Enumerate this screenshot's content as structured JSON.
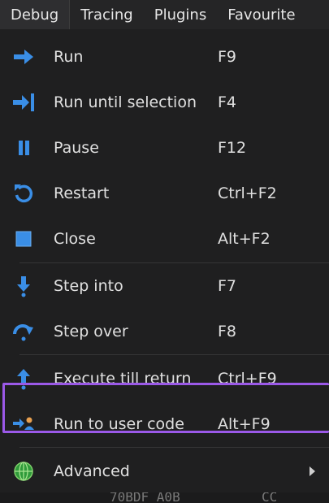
{
  "menubar": {
    "items": [
      {
        "label": "Debug"
      },
      {
        "label": "Tracing"
      },
      {
        "label": "Plugins"
      },
      {
        "label": "Favourite"
      }
    ]
  },
  "debug_menu": {
    "items": [
      {
        "label": "Run",
        "shortcut": "F9",
        "icon": "run-arrow-icon"
      },
      {
        "label": "Run until selection",
        "shortcut": "F4",
        "icon": "run-until-selection-icon"
      },
      {
        "label": "Pause",
        "shortcut": "F12",
        "icon": "pause-icon"
      },
      {
        "label": "Restart",
        "shortcut": "Ctrl+F2",
        "icon": "restart-icon"
      },
      {
        "label": "Close",
        "shortcut": "Alt+F2",
        "icon": "stop-icon"
      },
      {
        "label": "Step into",
        "shortcut": "F7",
        "icon": "step-into-icon"
      },
      {
        "label": "Step over",
        "shortcut": "F8",
        "icon": "step-over-icon"
      },
      {
        "label": "Execute till return",
        "shortcut": "Ctrl+F9",
        "icon": "execute-till-return-icon"
      },
      {
        "label": "Run to user code",
        "shortcut": "Alt+F9",
        "icon": "run-to-user-code-icon"
      },
      {
        "label": "Advanced",
        "shortcut": "",
        "icon": "globe-icon"
      }
    ],
    "highlighted_item": "Execute till return",
    "highlight_color": "#9b59e8"
  },
  "behind": {
    "text_left": "70BDF A0B",
    "text_right": "CC"
  },
  "colors": {
    "menubar_bg": "#252526",
    "menu_bg": "#1f1f20",
    "icon_blue": "#3a8ee6"
  }
}
